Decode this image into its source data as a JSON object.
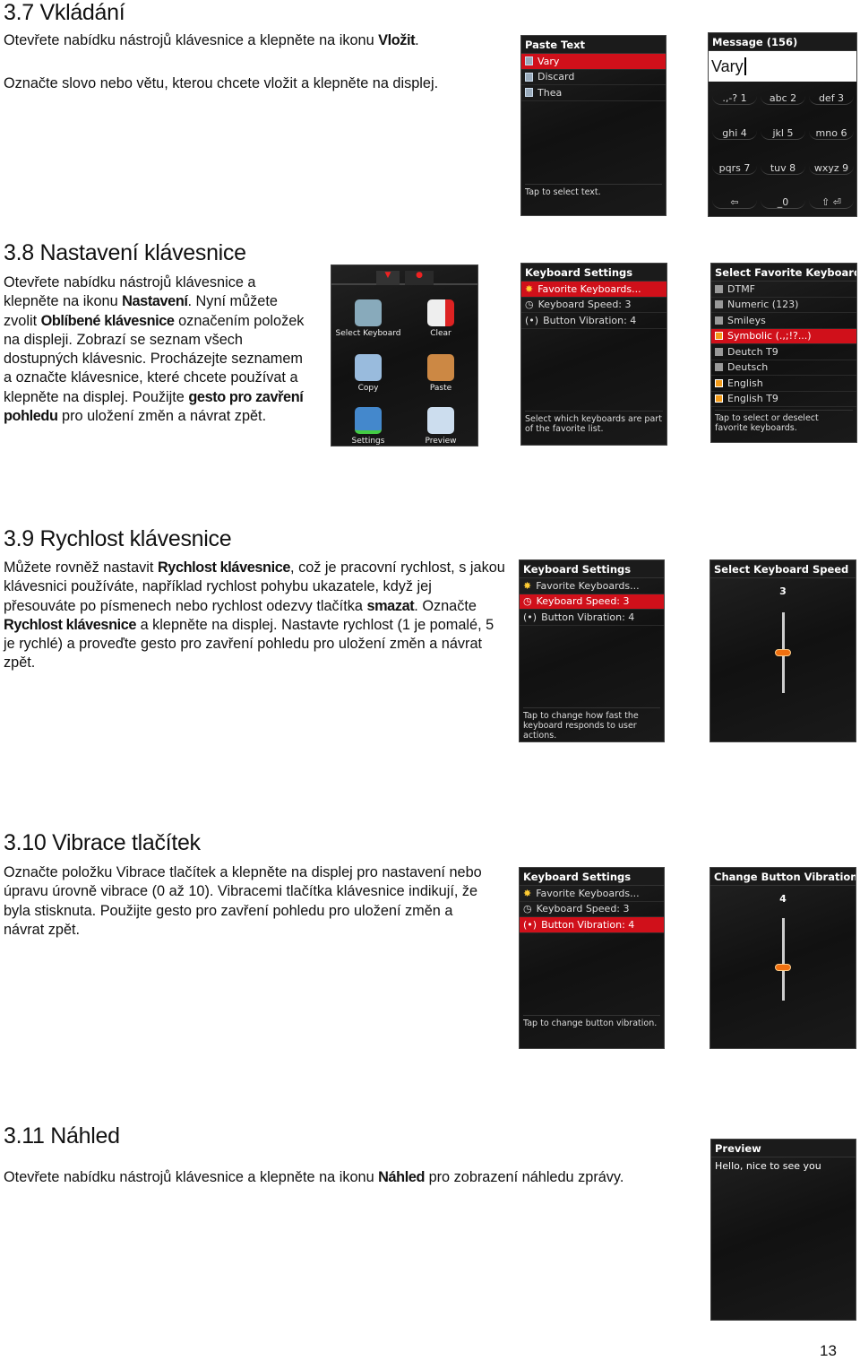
{
  "s37": {
    "title": "3.7 Vkládání",
    "p1": [
      "Otevřete nabídku nástrojů klávesnice a klepněte na ikonu ",
      "Vložit",
      "."
    ],
    "p2": "Označte slovo nebo větu, kterou chcete vložit a klepněte na displej."
  },
  "s38": {
    "title": "3.8 Nastavení klávesnice",
    "p": [
      "Otevřete nabídku nástrojů klávesnice a klepněte na ikonu ",
      "Nastavení",
      ". Nyní můžete zvolit ",
      "Oblíbené klávesnice",
      " označením položek na displeji. Zobrazí se seznam všech dostupných klávesnic. Procházejte seznamem a označte klávesnice, které chcete používat a klepněte na displej. Použijte ",
      "gesto pro zavření pohledu",
      " pro uložení změn a návrat zpět."
    ]
  },
  "s39": {
    "title": "3.9 Rychlost klávesnice",
    "p": [
      "Můžete rovněž nastavit ",
      "Rychlost klávesnice",
      ", což je pracovní rychlost, s jakou klávesnici používáte, například rychlost pohybu ukazatele, když jej přesouváte po písmenech nebo rychlost odezvy tlačítka ",
      "smazat",
      ". Označte ",
      "Rychlost klávesnice",
      " a klepněte na displej. Nastavte rychlost (1 je pomalé, 5 je rychlé) a proveďte gesto pro zavření pohledu pro uložení změn a návrat zpět."
    ]
  },
  "s310": {
    "title": "3.10 Vibrace tlačítek",
    "p": "Označte položku Vibrace tlačítek a klepněte na displej pro nastavení nebo úpravu úrovně vibrace (0 až 10). Vibracemi tlačítka klávesnice indikují, že byla stisknuta. Použijte gesto pro zavření pohledu pro uložení změn a návrat zpět."
  },
  "s311": {
    "title": "3.11 Náhled",
    "p": [
      "Otevřete nabídku nástrojů klávesnice a klepněte na ikonu ",
      "Náhled",
      " pro zobrazení náhledu zprávy."
    ]
  },
  "paste": {
    "title": "Paste Text",
    "items": [
      "Vary",
      "Discard",
      "Thea"
    ],
    "hint": "Tap to select text."
  },
  "message": {
    "title": "Message (156)",
    "text": "Vary",
    "keys": [
      ".,-? 1",
      "abc 2",
      "def 3",
      "ghi 4",
      "jkl 5",
      "mno 6",
      "pqrs 7",
      "tuv 8",
      "wxyz 9",
      "⇦",
      "_0",
      "⇧ ⏎"
    ]
  },
  "tools": {
    "items": [
      "Select Keyboard",
      "Clear",
      "Copy",
      "Paste",
      "Settings",
      "Preview"
    ]
  },
  "kbd": {
    "title": "Keyboard Settings",
    "items": [
      "Favorite Keyboards...",
      "Keyboard Speed: 3",
      "Button Vibration: 4"
    ],
    "hint_fav": "Select which keyboards are part of the favorite list.",
    "hint_speed": "Tap to change how fast the keyboard responds to user actions.",
    "hint_vib": "Tap to change button vibration."
  },
  "fav": {
    "title": "Select Favorite Keyboards",
    "items": [
      {
        "label": "DTMF",
        "checked": false
      },
      {
        "label": "Numeric (123)",
        "checked": false
      },
      {
        "label": "Smileys",
        "checked": false
      },
      {
        "label": "Symbolic (.,;!?...)",
        "checked": true
      },
      {
        "label": "Deutch T9",
        "checked": false
      },
      {
        "label": "Deutsch",
        "checked": false
      },
      {
        "label": "English",
        "checked": true
      },
      {
        "label": "English T9",
        "checked": true
      }
    ],
    "hint": "Tap to select or deselect favorite keyboards."
  },
  "speed": {
    "title": "Select Keyboard Speed",
    "value": "3",
    "level": 0.5
  },
  "vib": {
    "title": "Change Button Vibration",
    "value": "4",
    "level": 0.4
  },
  "preview": {
    "title": "Preview",
    "text": "Hello, nice to see you"
  },
  "page_number": "13",
  "colors": {
    "highlight": "#d0101a",
    "knob": "#f07010"
  }
}
